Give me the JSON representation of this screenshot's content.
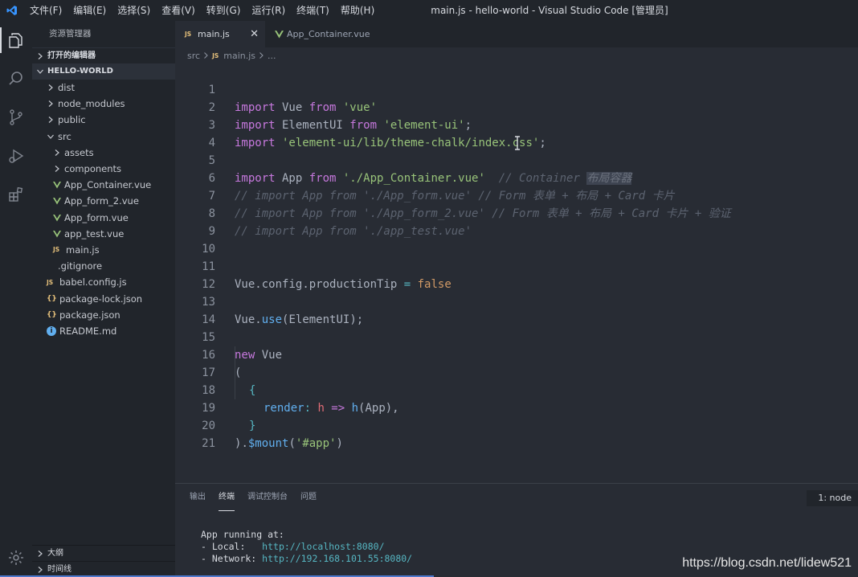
{
  "titlebar": {
    "menus": [
      "文件(F)",
      "编辑(E)",
      "选择(S)",
      "查看(V)",
      "转到(G)",
      "运行(R)",
      "终端(T)",
      "帮助(H)"
    ],
    "window_title": "main.js - hello-world - Visual Studio Code [管理员]"
  },
  "activitybar": {
    "icons": [
      "explorer-icon",
      "search-icon",
      "source-control-icon",
      "run-debug-icon",
      "extensions-icon",
      "settings-gear-icon"
    ]
  },
  "sidebar": {
    "title": "资源管理器",
    "open_editors": "打开的编辑器",
    "project": "HELLO-WORLD",
    "tree": {
      "dist": "dist",
      "node_modules": "node_modules",
      "public": "public",
      "src": "src",
      "assets": "assets",
      "components": "components",
      "app_container": "App_Container.vue",
      "app_form_2": "App_form_2.vue",
      "app_form": "App_form.vue",
      "app_test": "app_test.vue",
      "main_js": "main.js",
      "gitignore": ".gitignore",
      "babel_config": "babel.config.js",
      "package_lock": "package-lock.json",
      "package_json": "package.json",
      "readme": "README.md"
    },
    "outline": "大纲",
    "timeline": "时间线"
  },
  "tabs": {
    "main": "main.js",
    "container": "App_Container.vue",
    "js_badge": "JS",
    "close": "✕"
  },
  "breadcrumb": {
    "folder": "src",
    "file": "main.js",
    "more": "..."
  },
  "editor": {
    "line_numbers": [
      "1",
      "2",
      "3",
      "4",
      "5",
      "6",
      "7",
      "8",
      "9",
      "10",
      "11",
      "12",
      "13",
      "14",
      "15",
      "16",
      "17",
      "18",
      "19",
      "20",
      "21"
    ],
    "l1": {
      "kw1": "import",
      "id": " Vue ",
      "kw2": "from",
      "str": " 'vue'"
    },
    "l2": {
      "kw1": "import",
      "id": " ElementUI ",
      "kw2": "from",
      "str": " 'element-ui'",
      "end": ";"
    },
    "l3": {
      "kw1": "import",
      "str": " 'element-ui/lib/theme-chalk/index.css'",
      "end": ";"
    },
    "l5": {
      "kw1": "import",
      "id": " App ",
      "kw2": "from",
      "str": " './App_Container.vue'",
      "cm": "  // Container ",
      "cm_hl": "布局容器"
    },
    "l6": "// import App from './App_form.vue' // Form 表单 + 布局 + Card 卡片",
    "l7": "// import App from './App_form_2.vue' // Form 表单 + 布局 + Card 卡片 + 验证",
    "l8": "// import App from './app_test.vue'",
    "l11": {
      "obj": "Vue",
      "dot1": ".",
      "p1": "config",
      "dot2": ".",
      "p2": "productionTip",
      "eq": " = ",
      "val": "false"
    },
    "l13": {
      "obj": "Vue",
      "dot": ".",
      "fn": "use",
      "args": "(ElementUI);"
    },
    "l15": {
      "kw": "new",
      "id": " Vue"
    },
    "l16": "(",
    "l17": "{",
    "l18": {
      "key": "render",
      "colon": ": ",
      "param": "h",
      "arrow": " => ",
      "fn": "h",
      "args": "(App),"
    },
    "l19": "}",
    "l20": {
      "close": ")",
      "dot": ".",
      "fn": "$mount",
      "open": "(",
      "str": "'#app'",
      "end": ")"
    }
  },
  "panel": {
    "tabs": [
      "输出",
      "终端",
      "调试控制台",
      "问题"
    ],
    "active_tab": "终端",
    "terminal_select": "1: node",
    "terminal": {
      "line1": "App running at:",
      "local_label": "- Local:   ",
      "local_url": "http://localhost:8080/",
      "network_label": "- Network: ",
      "network_url": "http://192.168.101.55:8080/"
    }
  },
  "watermark": "https://blog.csdn.net/lidew521"
}
